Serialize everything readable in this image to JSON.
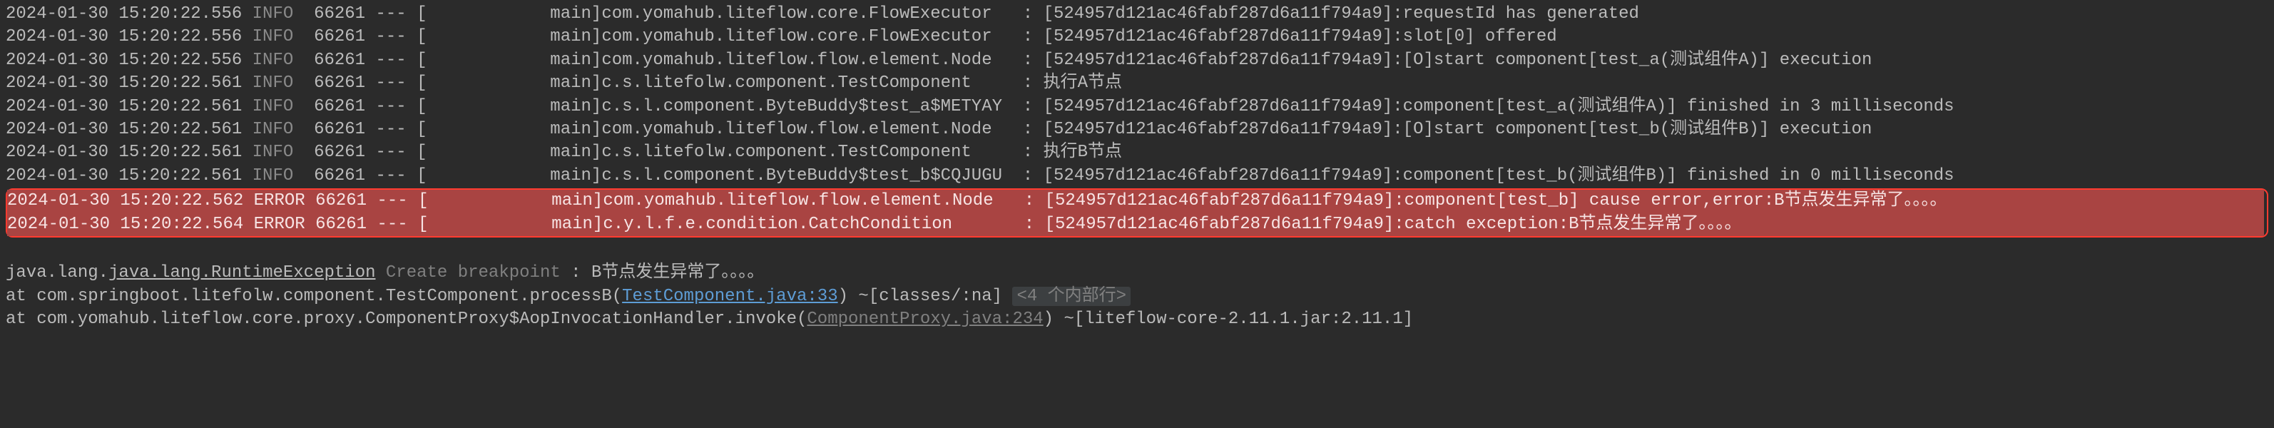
{
  "logs": [
    {
      "ts": "2024-01-30 15:20:22.556",
      "level": "INFO",
      "pid": "66261",
      "sep": "--- [",
      "thread": "main]",
      "logger": "com.yomahub.liteflow.core.FlowExecutor",
      "msg": "[524957d121ac46fabf287d6a11f794a9]:requestId has generated",
      "err": false
    },
    {
      "ts": "2024-01-30 15:20:22.556",
      "level": "INFO",
      "pid": "66261",
      "sep": "--- [",
      "thread": "main]",
      "logger": "com.yomahub.liteflow.core.FlowExecutor",
      "msg": "[524957d121ac46fabf287d6a11f794a9]:slot[0] offered",
      "err": false
    },
    {
      "ts": "2024-01-30 15:20:22.556",
      "level": "INFO",
      "pid": "66261",
      "sep": "--- [",
      "thread": "main]",
      "logger": "com.yomahub.liteflow.flow.element.Node",
      "msg": "[524957d121ac46fabf287d6a11f794a9]:[O]start component[test_a(测试组件A)] execution",
      "err": false
    },
    {
      "ts": "2024-01-30 15:20:22.561",
      "level": "INFO",
      "pid": "66261",
      "sep": "--- [",
      "thread": "main]",
      "logger": "c.s.litefolw.component.TestComponent",
      "msg": "执行A节点",
      "err": false
    },
    {
      "ts": "2024-01-30 15:20:22.561",
      "level": "INFO",
      "pid": "66261",
      "sep": "--- [",
      "thread": "main]",
      "logger": "c.s.l.component.ByteBuddy$test_a$METYAY",
      "msg": "[524957d121ac46fabf287d6a11f794a9]:component[test_a(测试组件A)] finished in 3 milliseconds",
      "err": false
    },
    {
      "ts": "2024-01-30 15:20:22.561",
      "level": "INFO",
      "pid": "66261",
      "sep": "--- [",
      "thread": "main]",
      "logger": "com.yomahub.liteflow.flow.element.Node",
      "msg": "[524957d121ac46fabf287d6a11f794a9]:[O]start component[test_b(测试组件B)] execution",
      "err": false
    },
    {
      "ts": "2024-01-30 15:20:22.561",
      "level": "INFO",
      "pid": "66261",
      "sep": "--- [",
      "thread": "main]",
      "logger": "c.s.litefolw.component.TestComponent",
      "msg": "执行B节点",
      "err": false
    },
    {
      "ts": "2024-01-30 15:20:22.561",
      "level": "INFO",
      "pid": "66261",
      "sep": "--- [",
      "thread": "main]",
      "logger": "c.s.l.component.ByteBuddy$test_b$CQJUGU",
      "msg": "[524957d121ac46fabf287d6a11f794a9]:component[test_b(测试组件B)] finished in 0 milliseconds",
      "err": false
    }
  ],
  "errorLogs": [
    {
      "ts": "2024-01-30 15:20:22.562",
      "level": "ERROR",
      "pid": "66261",
      "sep": "--- [",
      "thread": "main]",
      "logger": "com.yomahub.liteflow.flow.element.Node",
      "msg": "[524957d121ac46fabf287d6a11f794a9]:component[test_b] cause error,error:B节点发生异常了。。。。",
      "err": true
    },
    {
      "ts": "2024-01-30 15:20:22.564",
      "level": "ERROR",
      "pid": "66261",
      "sep": "--- [",
      "thread": "main]",
      "logger": "c.y.l.f.e.condition.CatchCondition",
      "msg": "[524957d121ac46fabf287d6a11f794a9]:catch exception:B节点发生异常了。。。。",
      "err": true
    }
  ],
  "stack": {
    "exceptionType": "java.lang.RuntimeException",
    "breakpointHint": "Create breakpoint",
    "breakpointSep": " : ",
    "exceptionMsg": "B节点发生异常了。。。。",
    "frames": [
      {
        "prefix": "    at com.springboot.litefolw.component.TestComponent.processB(",
        "link": "TestComponent.java:33",
        "suffix": ") ~[classes/:na] ",
        "collapsed": "<4 个内部行>"
      },
      {
        "prefix": "    at com.yomahub.liteflow.core.proxy.ComponentProxy$AopInvocationHandler.invoke(",
        "link": "ComponentProxy.java:234",
        "suffix": ") ~[liteflow-core-2.11.1.jar:2.11.1]",
        "collapsed": ""
      }
    ]
  },
  "colon": ": ",
  "javaLangPrefix": "java.lang."
}
